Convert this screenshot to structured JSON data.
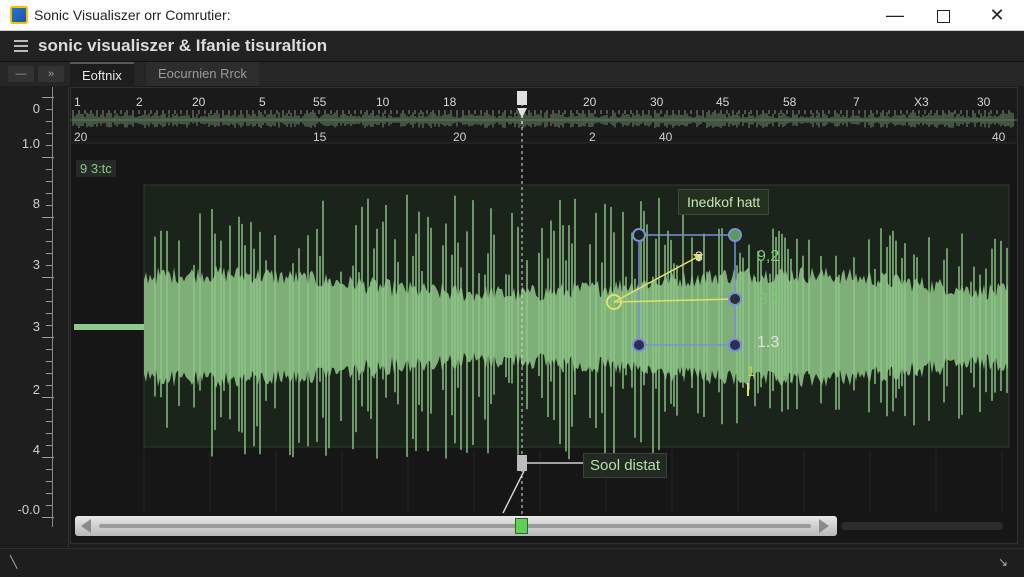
{
  "window": {
    "title": "Sonic Visualiszer orr Comrutier:",
    "min_icon": "minimize-icon",
    "max_icon": "maximize-icon",
    "close_glyph": "✕"
  },
  "header": {
    "title": "sonic visualiszer & Ifanie tisuraltion",
    "menu_icon": "hamburger-menu-icon"
  },
  "tabs": {
    "controls": [
      "—",
      "»"
    ],
    "items": [
      {
        "label": "Eoftnix",
        "active": true
      },
      {
        "label": "Eocurnien Rrck",
        "active": false
      }
    ]
  },
  "left_ruler": {
    "labels": [
      "0",
      "1.0",
      "8",
      "3",
      "3",
      "2",
      "4",
      "-0.0"
    ]
  },
  "timeline": {
    "top_numbers": [
      "1",
      "2",
      "20",
      "5",
      "55",
      "10",
      "18",
      "20",
      "30",
      "45",
      "58",
      "7",
      "X3",
      "30"
    ],
    "sub_numbers": [
      "20",
      "15",
      "20",
      "2",
      "40",
      "40"
    ]
  },
  "layer": {
    "label": "9 3:tc"
  },
  "annotation": {
    "box_label": "Inedkof hatt",
    "marker_label": "3",
    "values": [
      "9,2",
      "3 2",
      "1.3",
      "1"
    ]
  },
  "cursor": {
    "label": "Sool distat"
  },
  "scrollbar": {
    "left_icon": "scroll-left-icon",
    "right_icon": "scroll-right-icon"
  },
  "colors": {
    "waveform": "#8fc88a",
    "background": "#161616",
    "annotation_line": "#e3e06a",
    "handles": "#7a8fd8",
    "selection_panel": "#1b241a"
  },
  "statusbar": {
    "left_glyph": "╲",
    "right_glyph": "↘"
  }
}
